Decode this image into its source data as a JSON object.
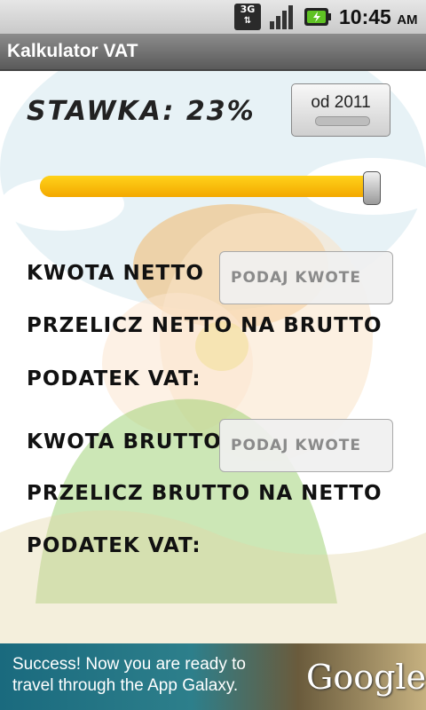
{
  "status_bar": {
    "network": "3G",
    "time": "10:45",
    "ampm": "AM"
  },
  "app": {
    "title": "Kalkulator VAT"
  },
  "rate": {
    "label": "STAWKA: 23%",
    "button_label": "od 2011",
    "slider_level": 0.98
  },
  "netto": {
    "amount_label": "KWOTA NETTO",
    "input_placeholder": "PODAJ KWOTE",
    "convert_label": "PRZELICZ NETTO NA BRUTTO",
    "vat_label": "PODATEK VAT:"
  },
  "brutto": {
    "amount_label": "KWOTA BRUTTO",
    "input_placeholder": "PODAJ KWOTE",
    "convert_label": "PRZELICZ BRUTTO NA NETTO",
    "vat_label": "PODATEK VAT:"
  },
  "ad": {
    "line1": "Success! Now you are ready to",
    "line2": "travel through the App Galaxy.",
    "brand": "Google"
  },
  "colors": {
    "slider_fill": "#f7b500",
    "titlebar": "#6e6e6e",
    "ad_bg": "#1f6f80"
  }
}
